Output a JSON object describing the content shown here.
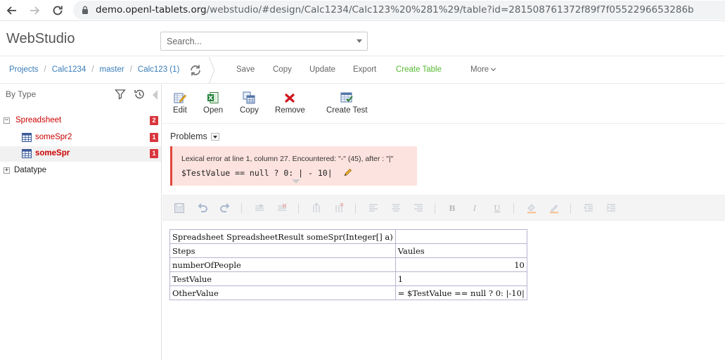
{
  "browser": {
    "url_host": "demo.openl-tablets.org",
    "url_path": "/webstudio/#design/Calc1234/Calc123%20%281%29/table?id=281508761372f89f7f0552296653286b"
  },
  "header": {
    "app_title": "WebStudio",
    "search_placeholder": "Search..."
  },
  "breadcrumbs": {
    "items": [
      "Projects",
      "Calc1234",
      "master",
      "Calc123 (1)"
    ],
    "separator": "/"
  },
  "menu": {
    "items": [
      "Save",
      "Copy",
      "Update",
      "Export",
      "Create Table",
      "More"
    ]
  },
  "sidebar": {
    "title": "By Type",
    "tree": [
      {
        "label": "Spreadsheet",
        "count": "2",
        "toggle": "−"
      },
      {
        "label": "someSpr2",
        "count": "1"
      },
      {
        "label": "someSpr",
        "count": "1"
      },
      {
        "label": "Datatype",
        "toggle": "+"
      }
    ]
  },
  "actions": {
    "items": [
      "Edit",
      "Open",
      "Copy",
      "Remove",
      "Create Test"
    ]
  },
  "problems": {
    "title": "Problems",
    "message": "Lexical error at line 1, column 27.  Encountered: \"-\" (45), after : \"|\"",
    "code": "$TestValue == null ? 0: | - 10|"
  },
  "table": {
    "rows": [
      [
        "Spreadsheet SpreadsheetResult someSpr(Integer[] a)",
        ""
      ],
      [
        "Steps",
        "Vaules"
      ],
      [
        "numberOfPeople",
        "10"
      ],
      [
        "TestValue",
        "1"
      ],
      [
        "OtherValue",
        "= $TestValue == null ? 0: |-10|"
      ]
    ]
  },
  "colors": {
    "accent_link": "#3a7cb8",
    "green": "#56b930",
    "error_red": "#d9363e",
    "error_bg": "#fde3df"
  }
}
